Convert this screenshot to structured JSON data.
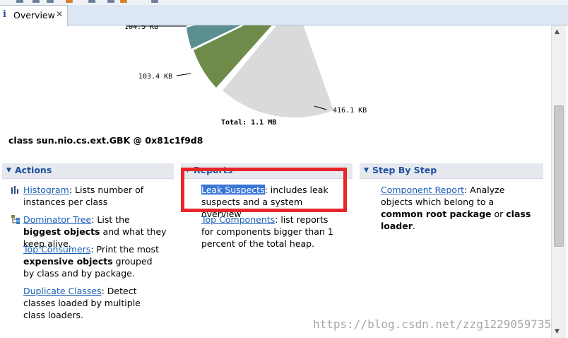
{
  "tab": {
    "label": "Overview",
    "info_glyph": "i",
    "close_glyph": "✕"
  },
  "chart_data": {
    "type": "pie",
    "total_label": "Total: 1.1 MB",
    "slices": [
      {
        "label": "104.5 KB",
        "color": "#5b8e91"
      },
      {
        "label": "103.4 KB",
        "color": "#6e8b4a"
      },
      {
        "label": "416.1 KB",
        "color": "#dadada"
      }
    ]
  },
  "object_title": "class sun.nio.cs.ext.GBK @ 0x81c1f9d8",
  "actions": {
    "title": "Actions",
    "histogram": {
      "link": "Histogram",
      "text": ": Lists number of instances per class"
    },
    "dominator": {
      "link": "Dominator Tree",
      "t1": ": List the ",
      "b1": "biggest objects",
      "t2": " and what they keep alive."
    },
    "consumers": {
      "link": "Top Consumers",
      "t1": ": Print the most ",
      "b1": "expensive objects",
      "t2": " grouped by class and by package."
    },
    "duplicates": {
      "link": "Duplicate Classes",
      "text": ": Detect classes loaded by multiple class loaders."
    }
  },
  "reports": {
    "title": "Reports",
    "leak": {
      "link": "Leak Suspects",
      "text": ": includes leak suspects and a system overview"
    },
    "components": {
      "link": "Top Components",
      "text": ": list reports for components bigger than 1 percent of the total heap."
    }
  },
  "stepbystep": {
    "title": "Step By Step",
    "component": {
      "link": "Component Report",
      "t1": ": Analyze objects which belong to a ",
      "b1": "common root package",
      "t2": " or ",
      "b2": "class loader",
      "t3": "."
    }
  },
  "watermark": "https://blog.csdn.net/zzg1229059735",
  "colors": {
    "link": "#1a5fb4",
    "heading": "#1f4e9e",
    "highlight": "#e8262a"
  }
}
